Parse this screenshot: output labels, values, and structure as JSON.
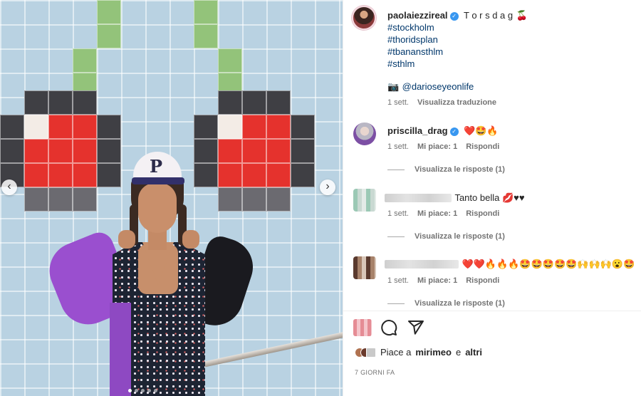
{
  "post": {
    "username": "paolaiezzireal",
    "caption_title": "T o r s d a g",
    "caption_emoji": "🍒",
    "hashtags": [
      "#stockholm",
      "#thoridsplan",
      "#tbanansthlm",
      "#sthlm"
    ],
    "credit_emoji": "📷",
    "credit_handle": "@darioseyeonlife",
    "time": "1 sett.",
    "translate": "Visualizza traduzione"
  },
  "photo": {
    "cap_letter": "P"
  },
  "comments": [
    {
      "username": "priscilla_drag",
      "verified": true,
      "text": "❤️🤩🔥",
      "time": "1 sett.",
      "likes": "Mi piace: 1",
      "reply": "Rispondi",
      "view_replies": "Visualizza le risposte (1)"
    },
    {
      "username_blurred": true,
      "text": "Tanto bella 💋♥♥",
      "time": "1 sett.",
      "likes": "Mi piace: 1",
      "reply": "Rispondi",
      "view_replies": "Visualizza le risposte (1)"
    },
    {
      "username_blurred": true,
      "text": "❤️❤️🔥🔥🔥🤩🤩🤩🤩🤩🙌🙌🙌😮🤩",
      "time": "1 sett.",
      "likes": "Mi piace: 1",
      "reply": "Rispondi",
      "view_replies": "Visualizza le risposte (1)"
    }
  ],
  "likes_row": {
    "prefix": "Piace a",
    "user": "mirimeo",
    "conj": "e",
    "others": "altri"
  },
  "date_label": "7 GIORNI FA",
  "icons": [
    "verified-badge-icon",
    "comment-icon",
    "share-icon",
    "prev-arrow-icon",
    "next-arrow-icon"
  ],
  "colors": {
    "link": "#00376b",
    "verified": "#3897f0",
    "meta": "#737373"
  }
}
